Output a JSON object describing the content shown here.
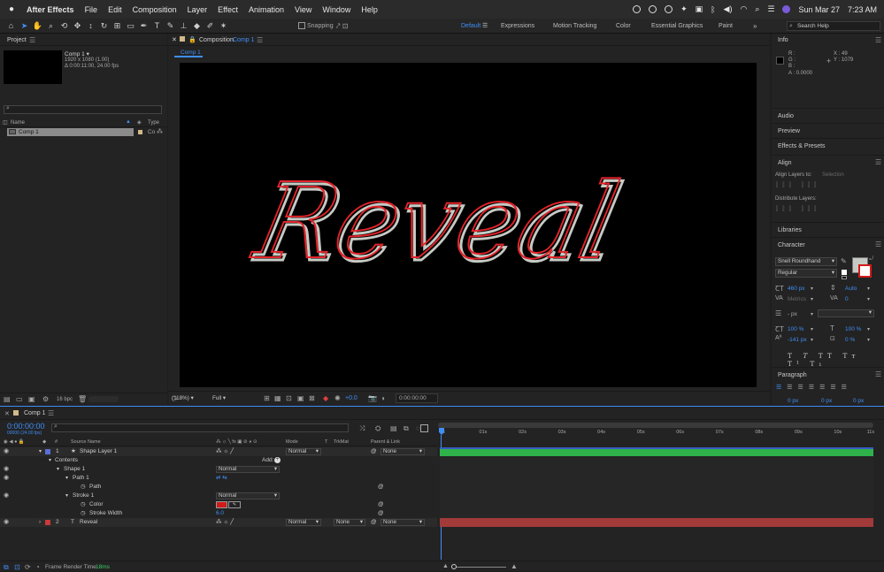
{
  "menubar": {
    "app": "After Effects",
    "items": [
      "File",
      "Edit",
      "Composition",
      "Layer",
      "Effect",
      "Animation",
      "View",
      "Window",
      "Help"
    ],
    "date": "Sun Mar 27",
    "time": "7:23 AM"
  },
  "toolbar": {
    "snapping": "Snapping",
    "workspaces": [
      "Default",
      "Expressions",
      "Motion Tracking",
      "Color",
      "Essential Graphics",
      "Paint"
    ],
    "active_workspace": "Default",
    "search_placeholder": "Search Help"
  },
  "project": {
    "title": "Project",
    "comp_name": "Comp 1 ▾",
    "comp_info1": "1920 x 1080 (1.00)",
    "comp_info2": "Δ 0:00:11:00, 24.00 fps",
    "col_name": "Name",
    "col_type": "Type",
    "item_name": "Comp 1",
    "item_type": "Co",
    "bpc": "16 bpc"
  },
  "composition": {
    "tab_prefix": "Composition",
    "tab_name": "Comp 1",
    "breadcrumb": "Comp 1",
    "text": "Reveal",
    "zoom": "(118%)",
    "resolution": "Full",
    "exposure": "+0.0",
    "timecode": "0:00:00:00"
  },
  "info": {
    "title": "Info",
    "r": "R :",
    "g": "G :",
    "b": "B :",
    "a": "A : 0.0000",
    "x": "X : 49",
    "y": "Y : 1079"
  },
  "sections": [
    "Audio",
    "Preview",
    "Effects & Presets"
  ],
  "align": {
    "title": "Align",
    "align_to": "Align Layers to:",
    "align_to_value": "Selection",
    "distribute": "Distribute Layers:"
  },
  "libraries": "Libraries",
  "character": {
    "title": "Character",
    "font": "Snell Roundhand",
    "style": "Regular",
    "size": "460 px",
    "leading": "Auto",
    "kerning": "Metrics",
    "tracking": "0",
    "stroke_unit": "- px",
    "vscale": "100 %",
    "hscale": "100 %",
    "baseline": "-141 px",
    "tsume": "0 %",
    "fill_color": "#c5cbc4",
    "stroke_color": "#d11a1a"
  },
  "paragraph": {
    "title": "Paragraph",
    "indent": "0 px"
  },
  "timeline": {
    "tab": "Comp 1",
    "timecode": "0:00:00:00",
    "frames": "00000 (24.00 fps)",
    "columns": {
      "num": "#",
      "source": "Source Name",
      "mode": "Mode",
      "t": "T",
      "trkmat": "TrkMat",
      "parent": "Parent & Link"
    },
    "rows": [
      {
        "num": "1",
        "name": "Shape Layer 1",
        "mode": "Normal",
        "parent": "None"
      },
      {
        "name": "Contents",
        "add": "Add:"
      },
      {
        "name": "Shape 1",
        "mode": "Normal"
      },
      {
        "name": "Path 1"
      },
      {
        "name": "Path"
      },
      {
        "name": "Stroke 1",
        "mode": "Normal"
      },
      {
        "name": "Color"
      },
      {
        "name": "Stroke Width",
        "value": "6.0"
      },
      {
        "num": "2",
        "name": "Reveal",
        "mode": "Normal",
        "trkmat": "None",
        "parent": "None"
      }
    ],
    "ruler": [
      "0s",
      "01s",
      "02s",
      "03s",
      "04s",
      "05s",
      "06s",
      "07s",
      "08s",
      "09s",
      "10s",
      "11s"
    ],
    "render_label": "Frame Render Time",
    "render_value": "18ms",
    "label_colors": {
      "layer1": "#5b6fd6",
      "layer2": "#c93a3a",
      "bar_green": "#2fb24a",
      "bar_blue": "#3a5cc4",
      "bar_red": "#a33a3a",
      "stroke_swatch": "#d11a1a"
    }
  }
}
